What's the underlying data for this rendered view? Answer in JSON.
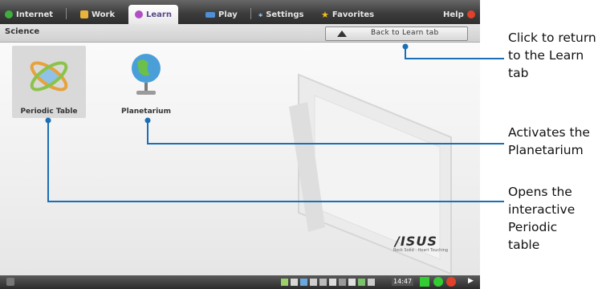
{
  "tabs": [
    {
      "label": "Internet",
      "icon": "globe-icon"
    },
    {
      "label": "Work",
      "icon": "folder-icon"
    },
    {
      "label": "Learn",
      "icon": "learn-icon",
      "active": true
    },
    {
      "label": "Play",
      "icon": "gamepad-icon"
    },
    {
      "label": "Settings",
      "icon": "settings-icon"
    },
    {
      "label": "Favorites",
      "icon": "star-icon"
    },
    {
      "label": "Help",
      "icon": "help-icon"
    }
  ],
  "breadcrumb": "Science",
  "back_button": "Back to Learn tab",
  "apps": [
    {
      "label": "Periodic Table",
      "icon": "periodic-table-icon",
      "selected": true
    },
    {
      "label": "Planetarium",
      "icon": "globe-icon"
    }
  ],
  "brand": {
    "logo": "/ISUS",
    "tagline": "Rock Solid · Heart Touching"
  },
  "taskbar": {
    "clock": "14:47"
  },
  "callouts": {
    "back": "Click to return to the Learn tab",
    "planetarium": "Activates the Planetarium",
    "periodic": "Opens the interactive Periodic table"
  },
  "colors": {
    "callout_line": "#1a6fb5",
    "tabbar": "#3c3c3c",
    "taskbar_green": "#33cc33"
  }
}
